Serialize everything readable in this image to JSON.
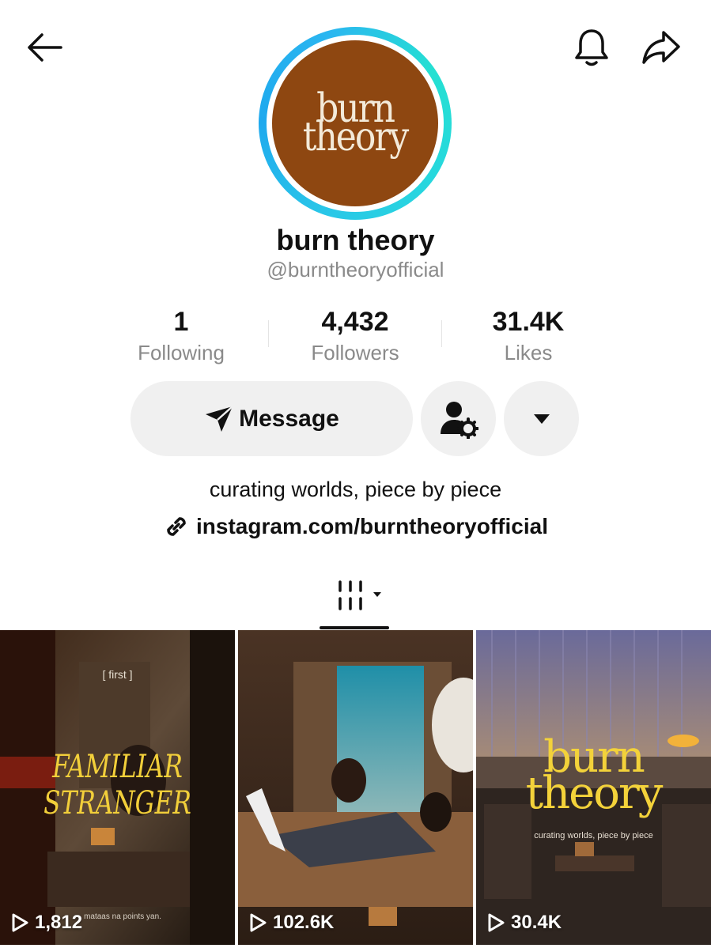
{
  "profile": {
    "avatar_logo_line1": "burn",
    "avatar_logo_line2": "theory",
    "display_name": "burn theory",
    "handle": "@burntheoryofficial",
    "bio": "curating worlds, piece by piece",
    "link": "instagram.com/burntheoryofficial"
  },
  "stats": [
    {
      "value": "1",
      "label": "Following"
    },
    {
      "value": "4,432",
      "label": "Followers"
    },
    {
      "value": "31.4K",
      "label": "Likes"
    }
  ],
  "actions": {
    "message_label": "Message"
  },
  "icons": {
    "back": "back-arrow-icon",
    "bell": "bell-icon",
    "share": "share-icon",
    "send": "send-icon",
    "user_settings": "user-gear-icon",
    "more": "caret-down-icon",
    "link": "link-icon",
    "grid": "grid-icon",
    "play": "play-icon"
  },
  "colors": {
    "avatar_bg": "#8e4711",
    "avatar_ring": "#1fc0ea",
    "secondary_text": "#8a8a8a",
    "pill_bg": "#f0f0f0"
  },
  "videos": [
    {
      "views": "1,812",
      "overlay_top": "[ first ]",
      "overlay_title_1": "FAMILIAR",
      "overlay_title_2": "STRANGER",
      "overlay_caption": "mataas na points yan."
    },
    {
      "views": "102.6K"
    },
    {
      "views": "30.4K",
      "overlay_title_1": "burn",
      "overlay_title_2": "theory",
      "overlay_caption": "curating worlds, piece by piece"
    }
  ]
}
